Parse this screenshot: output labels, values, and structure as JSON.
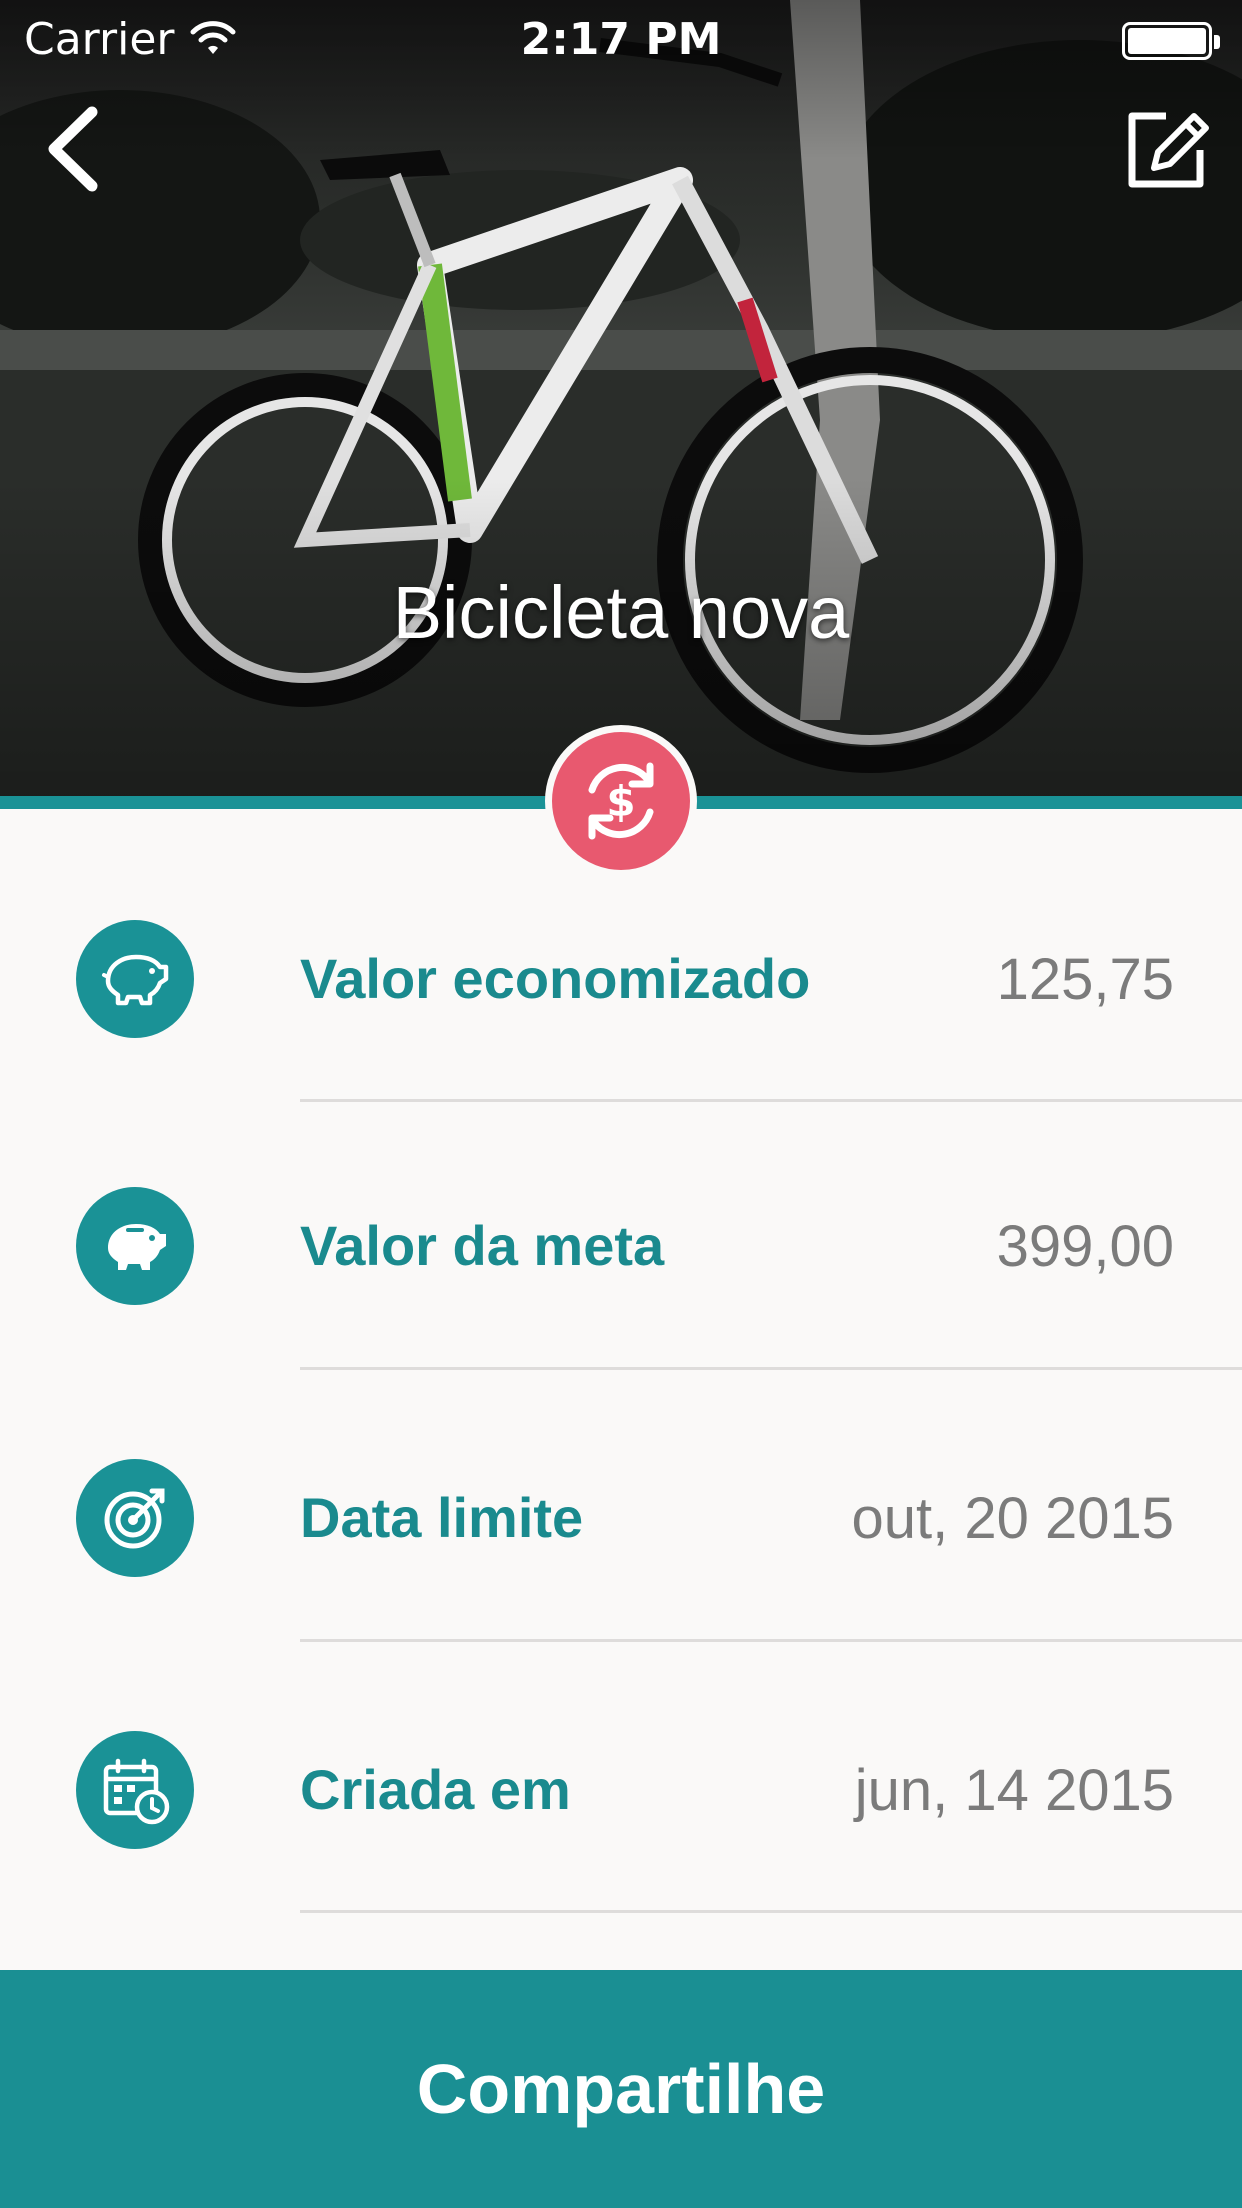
{
  "status_bar": {
    "carrier": "Carrier",
    "time": "2:17 PM"
  },
  "header": {
    "back_icon": "chevron-left-icon",
    "edit_icon": "edit-pencil-icon",
    "title": "Bicicleta nova",
    "badge_icon": "money-exchange-icon"
  },
  "details": [
    {
      "icon": "piggy-bank-outline-icon",
      "label": "Valor economizado",
      "value": "125,75"
    },
    {
      "icon": "piggy-bank-filled-icon",
      "label": "Valor da meta",
      "value": "399,00"
    },
    {
      "icon": "target-icon",
      "label": "Data limite",
      "value": "out, 20 2015"
    },
    {
      "icon": "calendar-clock-icon",
      "label": "Criada em",
      "value": "jun, 14 2015"
    }
  ],
  "footer": {
    "share_label": "Compartilhe"
  },
  "colors": {
    "accent": "#1a9296",
    "badge": "#e8596f",
    "label": "#1a8a8e",
    "value": "#7b7b7b",
    "background": "#faf9f8"
  }
}
